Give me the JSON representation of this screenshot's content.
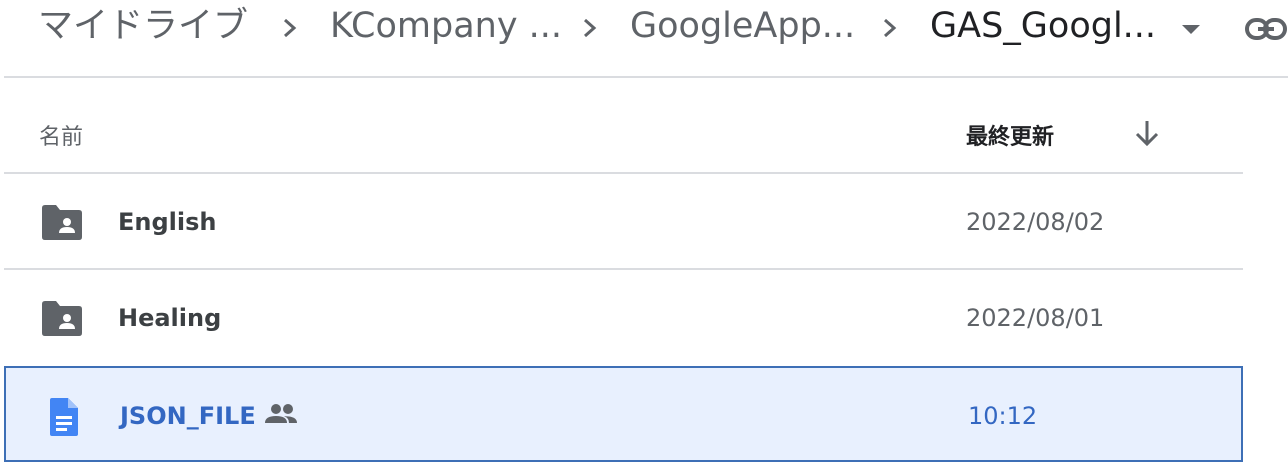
{
  "breadcrumb": {
    "items": [
      "マイドライブ",
      "KCompany ...",
      "GoogleApp...",
      "GAS_Googl..."
    ]
  },
  "header": {
    "name_label": "名前",
    "modified_label": "最終更新"
  },
  "files": [
    {
      "name": "English",
      "modified": "2022/08/02",
      "type": "shared-folder"
    },
    {
      "name": "Healing",
      "modified": "2022/08/01",
      "type": "shared-folder"
    },
    {
      "name": "JSON_FILE",
      "modified": "10:12",
      "type": "google-doc",
      "shared": true,
      "selected": true
    }
  ],
  "colors": {
    "selected_bg": "#e8f0fe",
    "selected_border": "#3d6fb6",
    "selected_text": "#3367c2",
    "doc_icon": "#4285f4",
    "folder_icon": "#5f6368"
  }
}
